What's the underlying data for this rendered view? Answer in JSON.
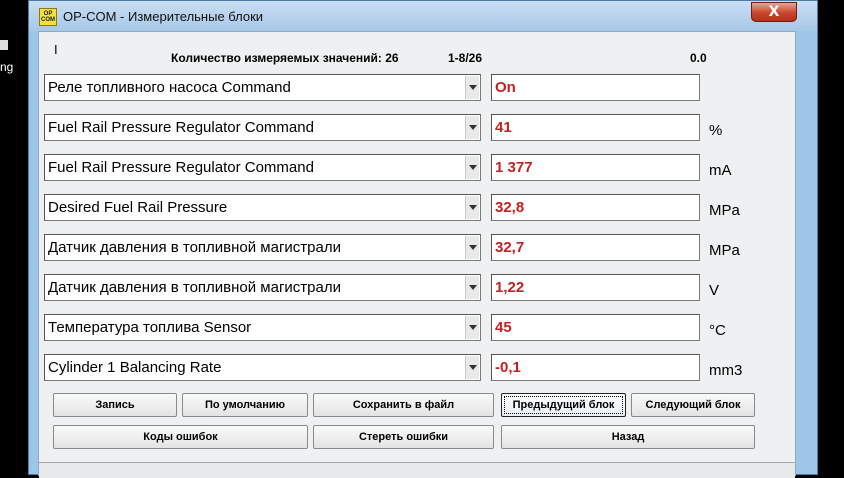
{
  "window": {
    "title": "OP-COM - Измерительные блоки",
    "logo_line1": "OP",
    "logo_line2": "COM",
    "close_label": "X"
  },
  "desktop": {
    "label": "ng"
  },
  "header": {
    "cursor": "I",
    "count_label": "Количество измеряемых значений: 26",
    "range": "1-8/26",
    "time": "0.0"
  },
  "rows": [
    {
      "name": "Реле топливного насоса Command",
      "value": "On",
      "unit": ""
    },
    {
      "name": "Fuel Rail Pressure Regulator Command",
      "value": "41",
      "unit": "%"
    },
    {
      "name": "Fuel Rail Pressure Regulator Command",
      "value": "1 377",
      "unit": "mA"
    },
    {
      "name": "Desired Fuel Rail Pressure",
      "value": "32,8",
      "unit": "MPa"
    },
    {
      "name": "Датчик давления в топливной магистрали",
      "value": "32,7",
      "unit": "MPa"
    },
    {
      "name": "Датчик давления в топливной магистрали",
      "value": "1,22",
      "unit": "V"
    },
    {
      "name": "Температура топлива Sensor",
      "value": "45",
      "unit": "°C"
    },
    {
      "name": "Cylinder 1 Balancing Rate",
      "value": "-0,1",
      "unit": "mm3"
    }
  ],
  "buttons": {
    "record": "Запись",
    "default": "По умолчанию",
    "save_file": "Сохранить в файл",
    "prev_block": "Предыдущий блок",
    "next_block": "Следующий блок",
    "error_codes": "Коды ошибок",
    "clear_errors": "Стереть ошибки",
    "back": "Назад"
  },
  "icons": {
    "dropdown": "chevron-down-icon",
    "close": "close-icon",
    "logo": "app-logo-icon"
  },
  "colors": {
    "value_text": "#c81e1e",
    "window_frame": "#9fc6e8",
    "close_button": "#c9452b"
  }
}
